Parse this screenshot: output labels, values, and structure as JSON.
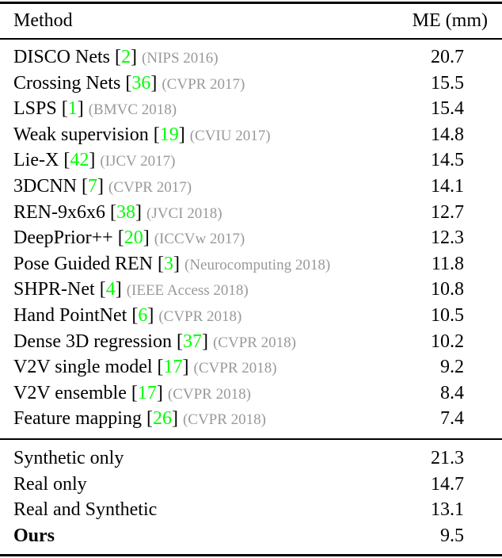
{
  "header": {
    "method": "Method",
    "metric": "ME (mm)"
  },
  "colors": {
    "citation": "#00ff00",
    "venue": "#999999",
    "text": "#000000"
  },
  "prior_methods": [
    {
      "name": "DISCO Nets",
      "ref": "2",
      "venue": "(NIPS 2016)",
      "me": "20.7"
    },
    {
      "name": "Crossing Nets",
      "ref": "36",
      "venue": "(CVPR 2017)",
      "me": "15.5"
    },
    {
      "name": "LSPS",
      "ref": "1",
      "venue": "(BMVC 2018)",
      "me": "15.4"
    },
    {
      "name": "Weak supervision",
      "ref": "19",
      "venue": "(CVIU 2017)",
      "me": "14.8"
    },
    {
      "name": "Lie-X",
      "ref": "42",
      "venue": "(IJCV 2017)",
      "me": "14.5"
    },
    {
      "name": "3DCNN",
      "ref": "7",
      "venue": "(CVPR 2017)",
      "me": "14.1"
    },
    {
      "name": "REN-9x6x6",
      "ref": "38",
      "venue": "(JVCI 2018)",
      "me": "12.7"
    },
    {
      "name": "DeepPrior++",
      "ref": "20",
      "venue": "(ICCVw 2017)",
      "me": "12.3"
    },
    {
      "name": "Pose Guided REN",
      "ref": "3",
      "venue": "(Neurocomputing 2018)",
      "me": "11.8"
    },
    {
      "name": "SHPR-Net",
      "ref": "4",
      "venue": "(IEEE Access 2018)",
      "me": "10.8"
    },
    {
      "name": "Hand PointNet",
      "ref": "6",
      "venue": "(CVPR 2018)",
      "me": "10.5"
    },
    {
      "name": "Dense 3D regression",
      "ref": "37",
      "venue": "(CVPR 2018)",
      "me": "10.2"
    },
    {
      "name": "V2V single model",
      "ref": "17",
      "venue": "(CVPR 2018)",
      "me": "9.2"
    },
    {
      "name": "V2V ensemble",
      "ref": "17",
      "venue": "(CVPR 2018)",
      "me": "8.4"
    },
    {
      "name": "Feature mapping",
      "ref": "26",
      "venue": "(CVPR 2018)",
      "me": "7.4"
    }
  ],
  "own_methods": [
    {
      "name": "Synthetic only",
      "me": "21.3"
    },
    {
      "name": "Real only",
      "me": "14.7"
    },
    {
      "name": "Real and Synthetic",
      "me": "13.1"
    },
    {
      "name": "Ours",
      "me": "9.5",
      "bold": true
    }
  ],
  "chart_data": {
    "type": "table",
    "columns": [
      "Method",
      "ME (mm)"
    ],
    "rows": [
      [
        "DISCO Nets [2] (NIPS 2016)",
        20.7
      ],
      [
        "Crossing Nets [36] (CVPR 2017)",
        15.5
      ],
      [
        "LSPS [1] (BMVC 2018)",
        15.4
      ],
      [
        "Weak supervision [19] (CVIU 2017)",
        14.8
      ],
      [
        "Lie-X [42] (IJCV 2017)",
        14.5
      ],
      [
        "3DCNN [7] (CVPR 2017)",
        14.1
      ],
      [
        "REN-9x6x6 [38] (JVCI 2018)",
        12.7
      ],
      [
        "DeepPrior++ [20] (ICCVw 2017)",
        12.3
      ],
      [
        "Pose Guided REN [3] (Neurocomputing 2018)",
        11.8
      ],
      [
        "SHPR-Net [4] (IEEE Access 2018)",
        10.8
      ],
      [
        "Hand PointNet [6] (CVPR 2018)",
        10.5
      ],
      [
        "Dense 3D regression [37] (CVPR 2018)",
        10.2
      ],
      [
        "V2V single model [17] (CVPR 2018)",
        9.2
      ],
      [
        "V2V ensemble [17] (CVPR 2018)",
        8.4
      ],
      [
        "Feature mapping [26] (CVPR 2018)",
        7.4
      ],
      [
        "Synthetic only",
        21.3
      ],
      [
        "Real only",
        14.7
      ],
      [
        "Real and Synthetic",
        13.1
      ],
      [
        "Ours",
        9.5
      ]
    ]
  }
}
